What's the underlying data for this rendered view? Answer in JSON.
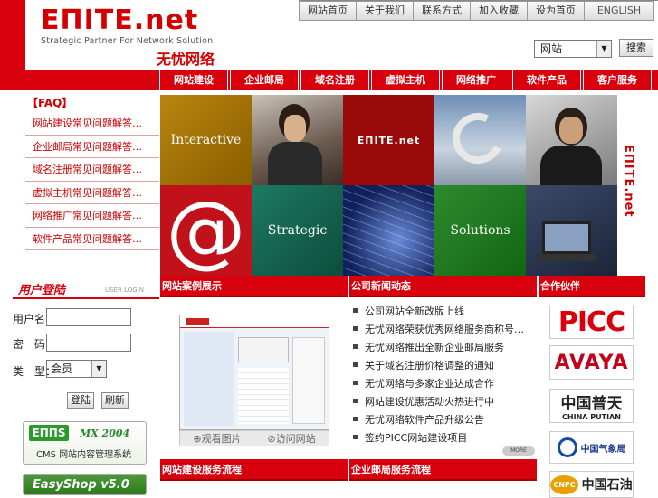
{
  "brand": {
    "logo_main": "EΠITE.net",
    "tagline": "Strategic Partner For Network Solution",
    "cn_name": "无忧网络",
    "side_text": "EΠITE.net"
  },
  "topnav": [
    "网站首页",
    "关于我们",
    "联系方式",
    "加入收藏",
    "设为首页",
    "ENGLISH"
  ],
  "search": {
    "option": "网站",
    "button": "搜索"
  },
  "mainnav": [
    "网站建设",
    "企业邮局",
    "域名注册",
    "虚拟主机",
    "网络推广",
    "软件产品",
    "客户服务"
  ],
  "faq": {
    "title": "【FAQ】",
    "items": [
      "网站建设常见问题解答…",
      "企业邮局常见问题解答…",
      "域名注册常见问题解答…",
      "虚拟主机常见问题解答…",
      "网络推广常见问题解答…",
      "软件产品常见问题解答…"
    ]
  },
  "mosaic": {
    "t1": "Interactive",
    "t2": "Strategic",
    "t3": "Solutions",
    "t4": "@",
    "t5": "EΠITE.net"
  },
  "login": {
    "title": "用户登陆",
    "subtitle": "USER LOGIN",
    "user_label": "用户名：",
    "pass_label": "密　码：",
    "type_label": "类　型：",
    "type_value": "会员",
    "login_btn": "登陆",
    "refresh_btn": "刷新"
  },
  "banners": {
    "cms_logo": "EΠΠS",
    "cms_ver": "MX 2004",
    "cms_desc": "CMS 网站内容管理系统",
    "shop": "EasyShop v5.0"
  },
  "sections": {
    "case": "网站案例展示",
    "news": "公司新闻动态",
    "partners": "合作伙伴",
    "bottom1": "网站建设服务流程",
    "bottom2": "企业邮局服务流程"
  },
  "case": {
    "view_pic": "观看图片",
    "visit_site": "访问网站"
  },
  "news": [
    "公司网站全新改版上线",
    "无忧网络荣获优秀网络服务商称号…",
    "无忧网络推出全新企业邮局服务",
    "关于域名注册价格调整的通知",
    "无忧网络与多家企业达成合作",
    "网站建设优惠活动火热进行中",
    "无忧网络软件产品升级公告",
    "签约PICC网站建设项目"
  ],
  "more": "MORE",
  "partners": {
    "p1": "PICC",
    "p2": "AVAYA",
    "p3_cn": "中国普天",
    "p3_en": "CHINA PUTIAN",
    "p4": "中国气象局",
    "p5": "中国石油",
    "p5_badge": "CNPC"
  }
}
